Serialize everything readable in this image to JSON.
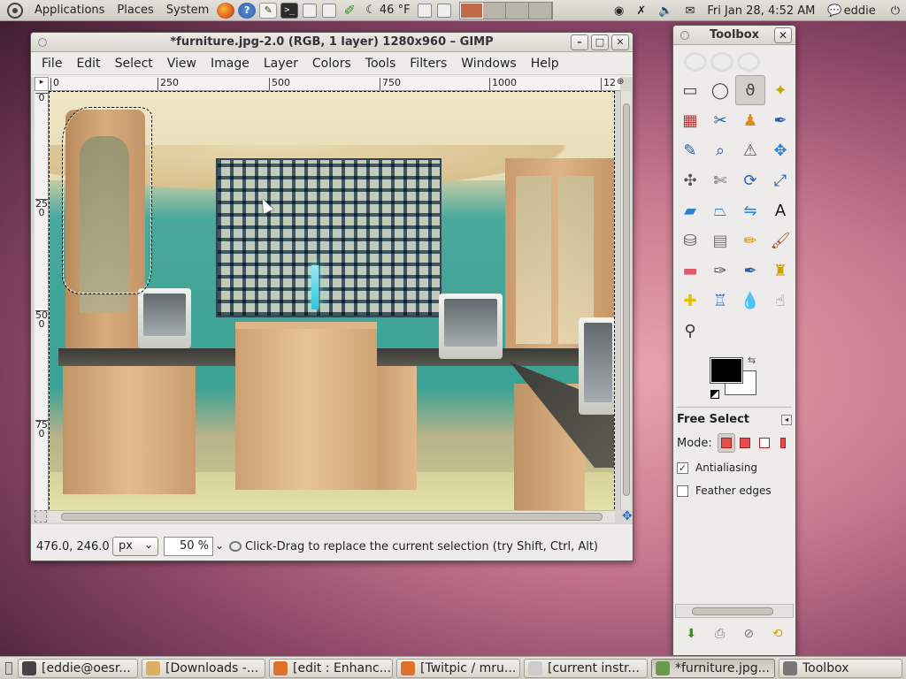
{
  "top_panel": {
    "menus": [
      "Applications",
      "Places",
      "System"
    ],
    "weather": "46 °F",
    "clock": "Fri Jan 28,  4:52 AM",
    "user": "eddie"
  },
  "image_window": {
    "title": "*furniture.jpg-2.0 (RGB, 1 layer) 1280x960 – GIMP",
    "menu": [
      "File",
      "Edit",
      "Select",
      "View",
      "Image",
      "Layer",
      "Colors",
      "Tools",
      "Filters",
      "Windows",
      "Help"
    ],
    "ruler_h": [
      "0",
      "250",
      "500",
      "750",
      "1000",
      "12"
    ],
    "ruler_v": [
      "0",
      "250",
      "500",
      "750"
    ],
    "status": {
      "coords": "476.0, 246.0",
      "unit": "px",
      "zoom": "50 %",
      "message": "Click-Drag to replace the current selection (try Shift, Ctrl, Alt)"
    }
  },
  "toolbox": {
    "title": "Toolbox",
    "tools": [
      {
        "name": "rect-select",
        "icon": "▭",
        "color": "#444444"
      },
      {
        "name": "ellipse-select",
        "icon": "◯",
        "color": "#444444"
      },
      {
        "name": "free-select",
        "icon": "ϑ",
        "color": "#444444"
      },
      {
        "name": "fuzzy-select",
        "icon": "✦",
        "color": "#c9a400"
      },
      {
        "name": "select-by-color",
        "icon": "▦",
        "color": "#c03030"
      },
      {
        "name": "scissors",
        "icon": "✂",
        "color": "#2b5fa8"
      },
      {
        "name": "foreground-select",
        "icon": "♟",
        "color": "#e08a1a"
      },
      {
        "name": "paths",
        "icon": "✒",
        "color": "#2b5fa8"
      },
      {
        "name": "color-picker",
        "icon": "✎",
        "color": "#2b5fa8"
      },
      {
        "name": "zoom",
        "icon": "⌕",
        "color": "#2b5fa8"
      },
      {
        "name": "measure",
        "icon": "⚠",
        "color": "#555555"
      },
      {
        "name": "move",
        "icon": "✥",
        "color": "#2b7fd0"
      },
      {
        "name": "align",
        "icon": "✣",
        "color": "#555555"
      },
      {
        "name": "crop",
        "icon": "✄",
        "color": "#555555"
      },
      {
        "name": "rotate",
        "icon": "⟳",
        "color": "#2b5fa8"
      },
      {
        "name": "scale",
        "icon": "⤢",
        "color": "#2b5fa8"
      },
      {
        "name": "shear",
        "icon": "▰",
        "color": "#2b7fd0"
      },
      {
        "name": "perspective",
        "icon": "⏢",
        "color": "#2b7fd0"
      },
      {
        "name": "flip",
        "icon": "⇋",
        "color": "#2b7fd0"
      },
      {
        "name": "text",
        "icon": "A",
        "color": "#111111"
      },
      {
        "name": "bucket-fill",
        "icon": "⛁",
        "color": "#555555"
      },
      {
        "name": "blend",
        "icon": "▤",
        "color": "#777777"
      },
      {
        "name": "pencil",
        "icon": "✏",
        "color": "#e08a1a"
      },
      {
        "name": "paintbrush",
        "icon": "🖌",
        "color": "#a0522d"
      },
      {
        "name": "eraser",
        "icon": "▬",
        "color": "#e05a6a"
      },
      {
        "name": "airbrush",
        "icon": "✑",
        "color": "#555555"
      },
      {
        "name": "ink",
        "icon": "✒",
        "color": "#2b5fa8"
      },
      {
        "name": "clone",
        "icon": "♜",
        "color": "#c9a400"
      },
      {
        "name": "heal",
        "icon": "✚",
        "color": "#e0c000"
      },
      {
        "name": "perspective-clone",
        "icon": "♖",
        "color": "#2b5fa8"
      },
      {
        "name": "blur",
        "icon": "💧",
        "color": "#3a8ad0"
      },
      {
        "name": "smudge",
        "icon": "☝",
        "color": "#c06a30"
      },
      {
        "name": "dodge-burn",
        "icon": "⚲",
        "color": "#333333"
      }
    ],
    "tool_options": {
      "title": "Free Select",
      "mode_label": "Mode:",
      "antialiasing": "Antialiasing",
      "feather": "Feather edges"
    }
  },
  "taskbar": [
    {
      "label": "[eddie@oesr...",
      "icon_color": "#444444"
    },
    {
      "label": "[Downloads -...",
      "icon_color": "#d8b060"
    },
    {
      "label": "[edit : Enhanc...",
      "icon_color": "#e0702a"
    },
    {
      "label": "[Twitpic / mru...",
      "icon_color": "#e0702a"
    },
    {
      "label": "[current instr...",
      "icon_color": "#cccccc"
    },
    {
      "label": "*furniture.jpg...",
      "icon_color": "#6a9a50"
    },
    {
      "label": "Toolbox",
      "icon_color": "#777777"
    }
  ]
}
